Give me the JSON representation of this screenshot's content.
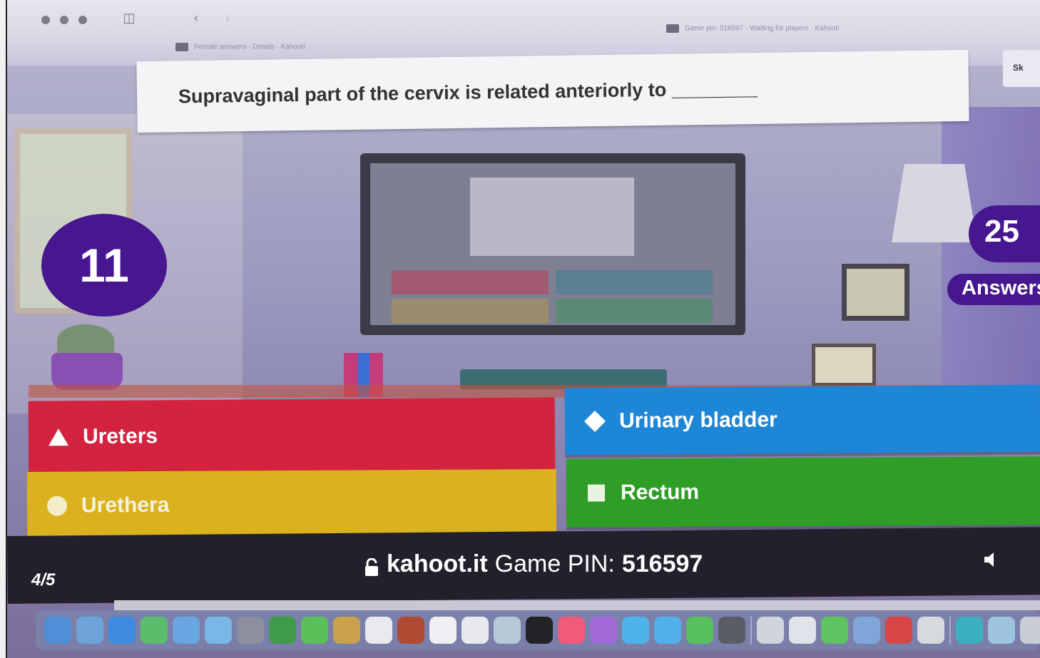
{
  "browser": {
    "tab_left": "Female answers · Details · Kahoot!",
    "tab_right": "Game pin: 516597 · Waiting for players · Kahoot!",
    "skip_label": "Sk"
  },
  "question": {
    "text": "Supravaginal part of the cervix is related anteriorly to ________"
  },
  "timer": {
    "seconds": "11"
  },
  "answers_count": {
    "value": "25",
    "label": "Answers"
  },
  "answers": [
    {
      "label": "Ureters",
      "shape": "triangle-icon",
      "color": "#d4233f"
    },
    {
      "label": "Urinary bladder",
      "shape": "diamond-icon",
      "color": "#1e86d6"
    },
    {
      "label": "Urethera",
      "shape": "circle-icon",
      "color": "#d9b21e"
    },
    {
      "label": "Rectum",
      "shape": "square-icon",
      "color": "#2f9e27"
    }
  ],
  "footer": {
    "progress": "4/5",
    "site": "kahoot.it",
    "pin_label": "Game PIN:",
    "pin": "516597"
  },
  "dock": {
    "apps": [
      "#4f8fd8",
      "#6ea3d9",
      "#3c8be0",
      "#5bbd6b",
      "#69a6df",
      "#79b7e6",
      "#8b8f9e",
      "#3f9b4a",
      "#5bbf5a",
      "#c9a24a",
      "#e9e9ef",
      "#b04a33",
      "#f0f0f4",
      "#e7e9ee",
      "#b5c9d8",
      "#222326",
      "#f05b7a",
      "#a26ad8",
      "#4cb4ea",
      "#4fb1e8",
      "#58c05c",
      "#5a5d66",
      "#cfd4dd",
      "#dfe3ea",
      "#5ec45f",
      "#7fa5d9",
      "#d84545",
      "#d6d9de",
      "#3db0c0",
      "#9fc4e0",
      "#c8cdd6"
    ]
  },
  "colors": {
    "kahoot_purple": "#46178f",
    "bottom_bar": "#23202c"
  }
}
